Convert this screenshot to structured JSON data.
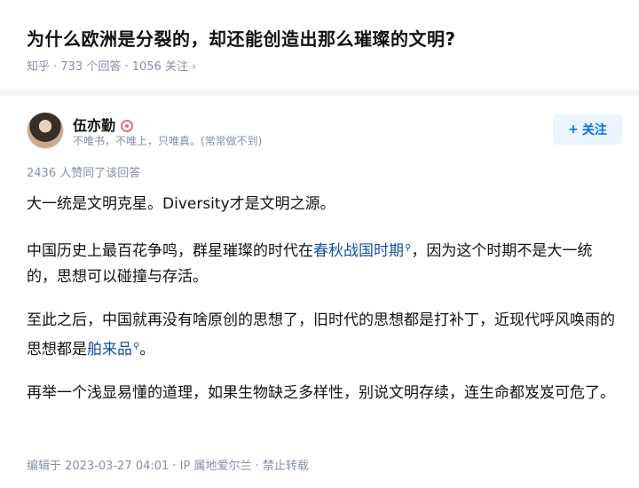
{
  "question": {
    "title": "为什么欧洲是分裂的，却还能创造出那么璀璨的文明?",
    "meta": "知乎 · 733 个回答 · 1056 关注",
    "meta_chevron": "›"
  },
  "author": {
    "name": "伍亦勤",
    "bio": "不唯书，不唯上，只唯真。(常常做不到)",
    "follow_plus": "+",
    "follow_label": "关注"
  },
  "answer": {
    "votes": "2436 人赞同了该回答",
    "p1": "大一统是文明克星。Diversity才是文明之源。",
    "p2_before": "中国历史上最百花争鸣，群星璀璨的时代在",
    "p2_link": "春秋战国时期",
    "p2_after": "，因为这个时期不是大一统的，思想可以碰撞与存活。",
    "p3_before": "至此之后，中国就再没有啥原创的思想了，旧时代的思想都是打补丁，近现代呼风唤雨的思想都是",
    "p3_link": "舶来品",
    "p3_after": "。",
    "p4": "再举一个浅显易懂的道理，如果生物缺乏多样性，别说文明存续，连生命都岌岌可危了。",
    "footer": "编辑于 2023-03-27 04:01 · IP 属地爱尔兰 · 禁止转载"
  },
  "colors": {
    "link": "#175199",
    "meta": "#8590a6",
    "follow_bg": "#ebf5ff",
    "follow_text": "#056de8"
  },
  "icons": {
    "search_glyph": "⚲",
    "badge": "badge-icon"
  }
}
